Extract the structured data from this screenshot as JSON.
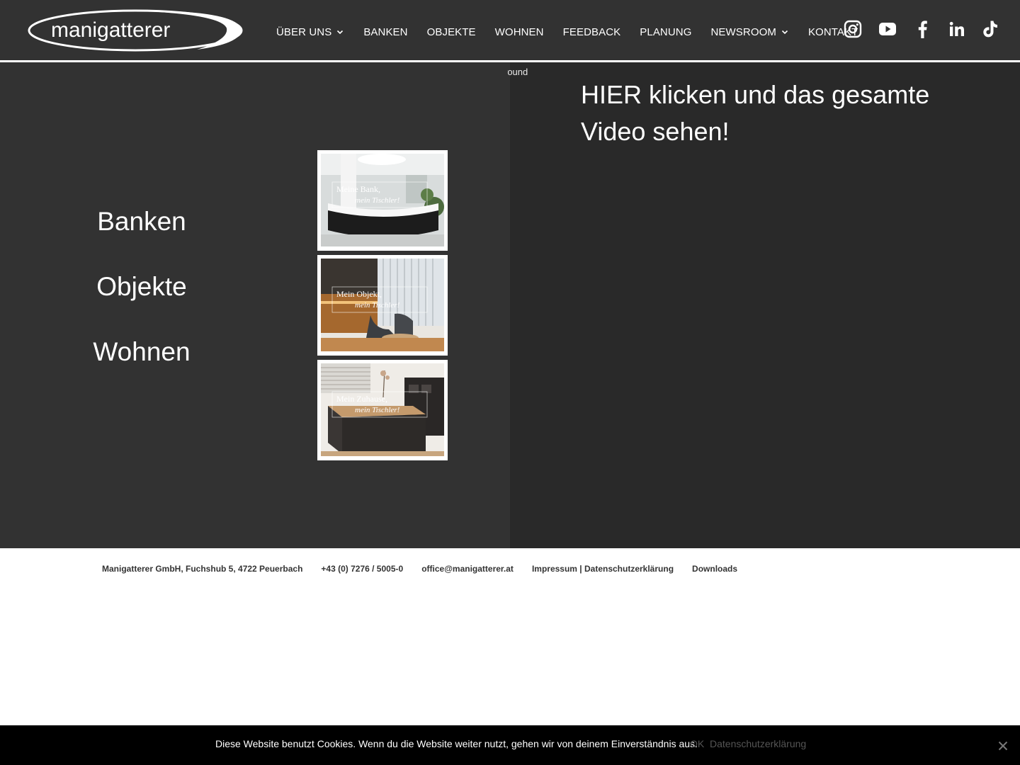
{
  "header": {
    "logo_text": "manigatterer",
    "nav": [
      {
        "label": "ÜBER UNS",
        "has_dropdown": true
      },
      {
        "label": "BANKEN",
        "has_dropdown": false
      },
      {
        "label": "OBJEKTE",
        "has_dropdown": false
      },
      {
        "label": "WOHNEN",
        "has_dropdown": false
      },
      {
        "label": "FEEDBACK",
        "has_dropdown": false
      },
      {
        "label": "PLANUNG",
        "has_dropdown": false
      },
      {
        "label": "NEWSROOM",
        "has_dropdown": true
      },
      {
        "label": "KONTAKT",
        "has_dropdown": false
      }
    ],
    "social_icons": [
      "instagram-icon",
      "youtube-icon",
      "facebook-icon",
      "linkedin-icon",
      "tiktok-icon"
    ]
  },
  "main": {
    "background_fragment": "round",
    "categories": [
      {
        "label": "Banken",
        "thumb_line1": "Meine Bank,",
        "thumb_line2": "mein Tischler!"
      },
      {
        "label": "Objekte",
        "thumb_line1": "Mein Objekt,",
        "thumb_line2": "mein Tischler!"
      },
      {
        "label": "Wohnen",
        "thumb_line1": "Mein Zuhause,",
        "thumb_line2": "mein Tischler!"
      }
    ],
    "video_title": "HIER klicken und das gesamte Video sehen!"
  },
  "footer": {
    "address": "Manigatterer GmbH, Fuchshub 5, 4722 Peuerbach",
    "phone": "+43 (0) 7276 / 5005-0",
    "email": "office@manigatterer.at",
    "legal": "Impressum | Datenschutzerklärung",
    "downloads": "Downloads"
  },
  "cookie_bar": {
    "text": "Diese Website benutzt Cookies. Wenn du die Website weiter nutzt, gehen wir von deinem Einverständnis aus.",
    "ok_label": "OK",
    "privacy_label": "Datenschutzerklärung"
  },
  "colors": {
    "header_bg": "#323232",
    "left_panel_bg": "#323232",
    "right_panel_bg": "#292929",
    "cookie_bg": "#000000",
    "text_light": "#ffffff",
    "footer_text": "#333333",
    "muted_link": "#555555"
  }
}
